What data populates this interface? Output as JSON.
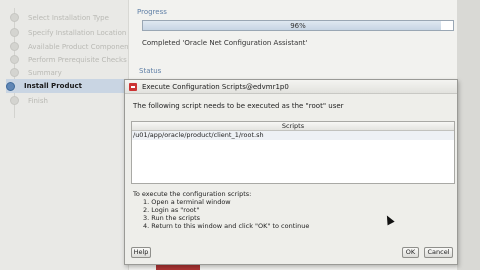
{
  "sidebar": {
    "items": [
      {
        "label": "Select Installation Type",
        "current": false
      },
      {
        "label": "Specify Installation Location",
        "current": false
      },
      {
        "label": "Available Product Components",
        "current": false
      },
      {
        "label": "Perform Prerequisite Checks",
        "current": false
      },
      {
        "label": "Summary",
        "current": false
      },
      {
        "label": "Install Product",
        "current": true
      },
      {
        "label": "Finish",
        "current": false
      }
    ]
  },
  "progress": {
    "title": "Progress",
    "percent_text": "96%",
    "fraction": 0.96,
    "status": "Completed 'Oracle Net Configuration Assistant'"
  },
  "status": {
    "title": "Status"
  },
  "dialog": {
    "title": "Execute Configuration Scripts@edvmr1p0",
    "message": "The following script needs to be executed as the \"root\" user",
    "table_header": "Scripts",
    "rows": [
      "/u01/app/oracle/product/client_1/root.sh"
    ],
    "instructions_title": "To execute the configuration scripts:",
    "steps": [
      "1. Open a terminal window",
      "2. Login as \"root\"",
      "3. Run the scripts",
      "4. Return to this window and click \"OK\" to continue"
    ],
    "help_label": "Help",
    "ok_label": "OK",
    "cancel_label": "Cancel"
  }
}
